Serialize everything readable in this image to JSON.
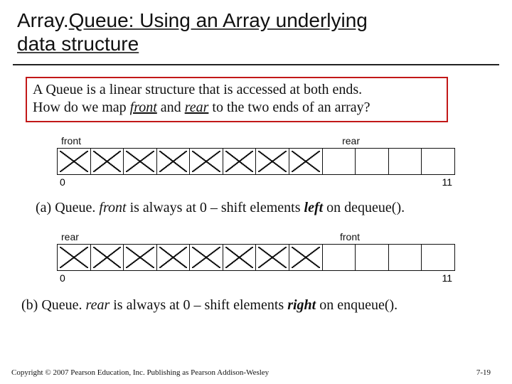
{
  "title": {
    "line1_a": "Array.",
    "line1_b": "Queue: Using an Array underlying",
    "line2": "data structure"
  },
  "intro": {
    "line1": "A Queue is a linear structure that is accessed at both ends.",
    "line2_pre": "How do we map ",
    "front": "front",
    "line2_mid": " and ",
    "rear": "rear",
    "line2_post": " to the two ends of an array?"
  },
  "fig_a": {
    "left_label": "front",
    "right_label": "rear",
    "filled_count": 8,
    "total": 12,
    "idx_start": "0",
    "idx_end": "11"
  },
  "caption_a": {
    "prefix": "(a) Queue.",
    "front": "front",
    "mid": " is always at 0 – shift elements ",
    "dir": "left",
    "post": " on dequeue()."
  },
  "fig_b": {
    "left_label": "rear",
    "right_label": "front",
    "filled_count": 8,
    "total": 12,
    "idx_start": "0",
    "idx_end": "11"
  },
  "caption_b": {
    "prefix": "(b) Queue.",
    "rear": "rear",
    "mid": " is always at 0 – shift elements ",
    "dir": "right",
    "post": " on enqueue()."
  },
  "footer": {
    "copyright": "Copyright © 2007 Pearson Education, Inc. Publishing as Pearson Addison-Wesley",
    "page": "7-19"
  },
  "chart_data": [
    {
      "type": "table",
      "caption": "(a) Queue: front fixed at index 0, elements shift left on dequeue()",
      "front_label": "front",
      "rear_label": "rear",
      "front_index": 0,
      "rear_index": 7,
      "array_length": 12,
      "indices_shown": [
        0,
        11
      ],
      "occupied_indices": [
        0,
        1,
        2,
        3,
        4,
        5,
        6,
        7
      ],
      "empty_indices": [
        8,
        9,
        10,
        11
      ]
    },
    {
      "type": "table",
      "caption": "(b) Queue: rear fixed at index 0, elements shift right on enqueue()",
      "rear_label": "rear",
      "front_label": "front",
      "rear_index": 0,
      "front_index": 7,
      "array_length": 12,
      "indices_shown": [
        0,
        11
      ],
      "occupied_indices": [
        0,
        1,
        2,
        3,
        4,
        5,
        6,
        7
      ],
      "empty_indices": [
        8,
        9,
        10,
        11
      ]
    }
  ]
}
